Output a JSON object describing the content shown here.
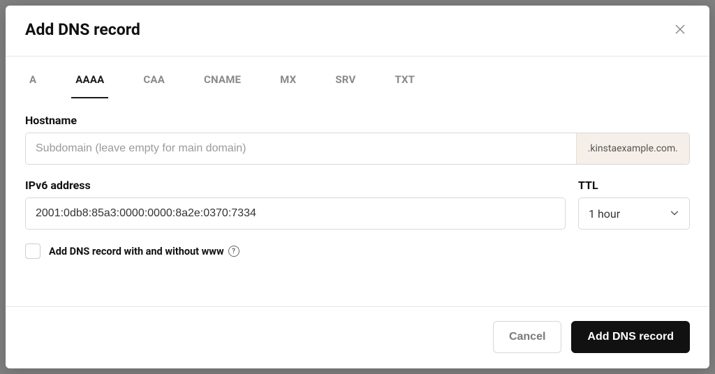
{
  "modal": {
    "title": "Add DNS record"
  },
  "tabs": [
    {
      "label": "A",
      "active": false
    },
    {
      "label": "AAAA",
      "active": true
    },
    {
      "label": "CAA",
      "active": false
    },
    {
      "label": "CNAME",
      "active": false
    },
    {
      "label": "MX",
      "active": false
    },
    {
      "label": "SRV",
      "active": false
    },
    {
      "label": "TXT",
      "active": false
    }
  ],
  "hostname": {
    "label": "Hostname",
    "placeholder": "Subdomain (leave empty for main domain)",
    "value": "",
    "suffix": ".kinstaexample.com."
  },
  "ipv6": {
    "label": "IPv6 address",
    "value": "2001:0db8:85a3:0000:0000:8a2e:0370:7334"
  },
  "ttl": {
    "label": "TTL",
    "value": "1 hour"
  },
  "checkbox": {
    "label": "Add DNS record with and without www",
    "checked": false
  },
  "footer": {
    "cancel": "Cancel",
    "submit": "Add DNS record"
  }
}
